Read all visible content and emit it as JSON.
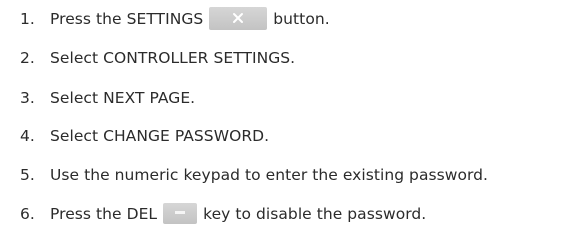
{
  "steps": [
    {
      "number": "1.",
      "pre": "Press the SETTINGS",
      "post": "button.",
      "icon": "tools-icon"
    },
    {
      "number": "2.",
      "text": "Select CONTROLLER SETTINGS."
    },
    {
      "number": "3.",
      "text": "Select NEXT PAGE."
    },
    {
      "number": "4.",
      "text": "Select CHANGE PASSWORD."
    },
    {
      "number": "5.",
      "text": "Use the numeric keypad to enter the existing password."
    },
    {
      "number": "6.",
      "pre": "Press the DEL",
      "post": "key to disable the password.",
      "icon": "del-key-icon"
    }
  ],
  "colors": {
    "text": "#2b2b2b",
    "button_gray": "#cfcfcf",
    "icon_white": "#ffffff"
  }
}
